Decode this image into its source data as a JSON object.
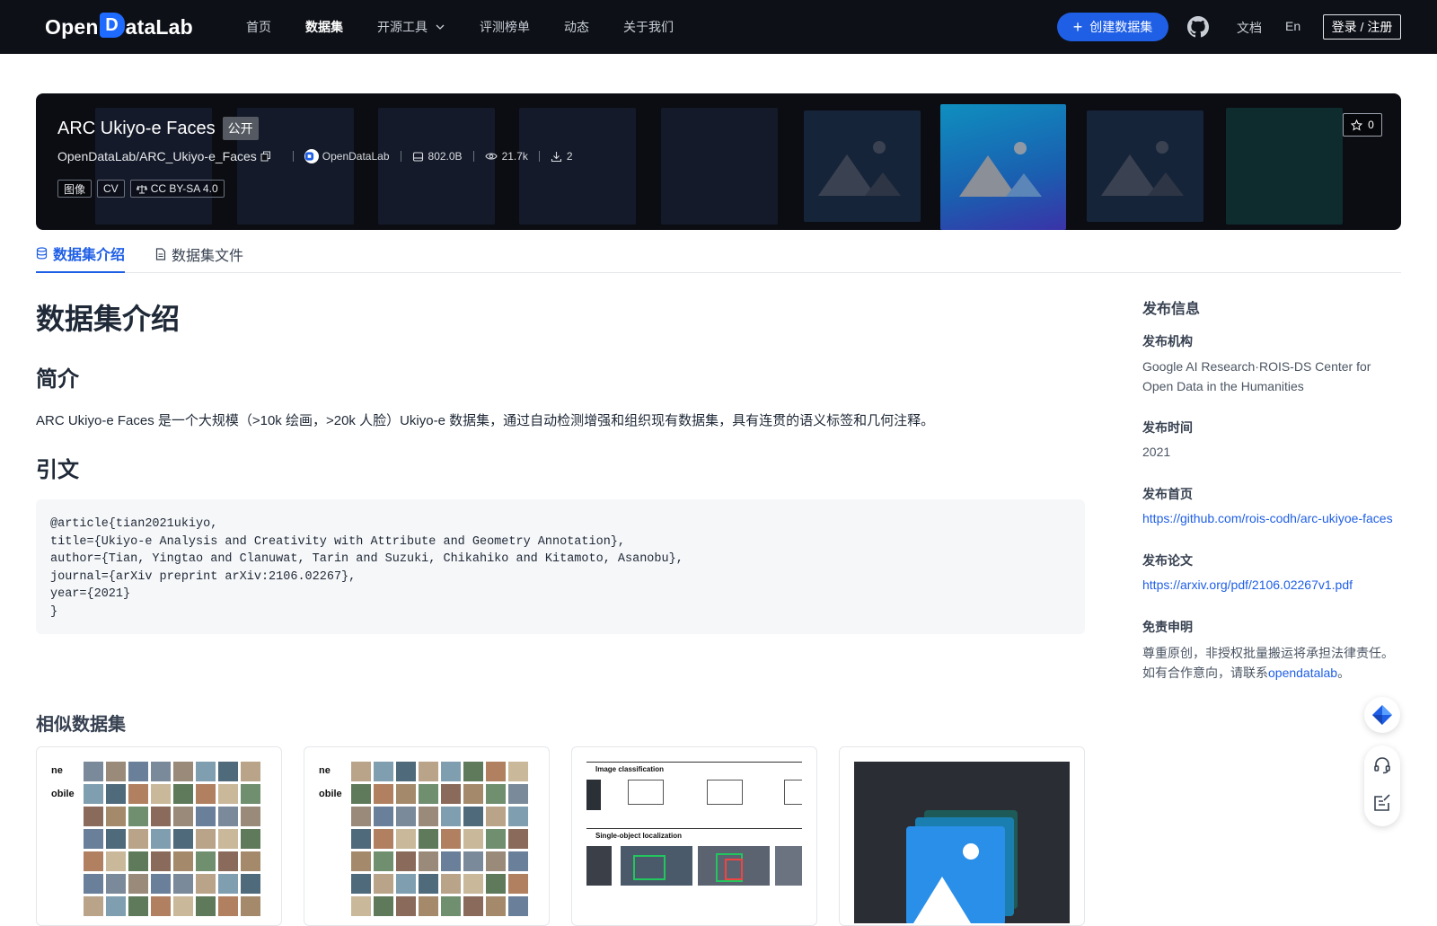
{
  "nav": {
    "logo_text_a": "Open",
    "logo_text_d": "D",
    "logo_text_b": "ataLab",
    "links": [
      "首页",
      "数据集",
      "开源工具",
      "评测榜单",
      "动态",
      "关于我们"
    ],
    "create_label": "创建数据集",
    "docs_label": "文档",
    "lang_label": "En",
    "login_label": "登录 / 注册"
  },
  "dataset": {
    "title": "ARC Ukiyo-e Faces",
    "visibility": "公开",
    "path": "OpenDataLab/ARC_Ukiyo-e_Faces",
    "org": "OpenDataLab",
    "size": "802.0B",
    "views": "21.7k",
    "downloads": "2",
    "tags": [
      "图像",
      "CV",
      "CC BY-SA 4.0"
    ],
    "stars": "0"
  },
  "tabs": [
    "数据集介绍",
    "数据集文件"
  ],
  "content": {
    "h1": "数据集介绍",
    "intro_heading": "简介",
    "intro_text": "ARC Ukiyo-e Faces 是一个大规模（>10k 绘画，>20k 人脸）Ukiyo-e 数据集，通过自动检测增强和组织现有数据集，具有连贯的语义标签和几何注释。",
    "citation_heading": "引文",
    "citation": "@article{tian2021ukiyo,\ntitle={Ukiyo-e Analysis and Creativity with Attribute and Geometry Annotation},\nauthor={Tian, Yingtao and Clanuwat, Tarin and Suzuki, Chikahiko and Kitamoto, Asanobu},\njournal={arXiv preprint arXiv:2106.02267},\nyear={2021}\n}",
    "similar_heading": "相似数据集"
  },
  "cards": {
    "c1_side_a": "ne",
    "c1_side_b": "obile",
    "c2_side_a": "ne",
    "c2_side_b": "obile",
    "c3_heading_a": "Image classification",
    "c3_heading_b": "Single-object localization"
  },
  "sidebar": {
    "heading": "发布信息",
    "org_label": "发布机构",
    "org_value": "Google AI Research·ROIS-DS Center for Open Data in the Humanities",
    "time_label": "发布时间",
    "time_value": "2021",
    "home_label": "发布首页",
    "home_value": "https://github.com/rois-codh/arc-ukiyoe-faces",
    "paper_label": "发布论文",
    "paper_value": "https://arxiv.org/pdf/2106.02267v1.pdf",
    "disclaimer_label": "免责申明",
    "disclaimer_line1": "尊重原创，非授权批量搬运将承担法律责任。",
    "disclaimer_line2_pre": "如有合作意向，请联系",
    "disclaimer_link": "opendatalab",
    "disclaimer_end": "。"
  },
  "colors": {
    "accent": "#1f5fe6",
    "nav_bg": "#0d1017",
    "banner_bg": "#0b0d12"
  }
}
